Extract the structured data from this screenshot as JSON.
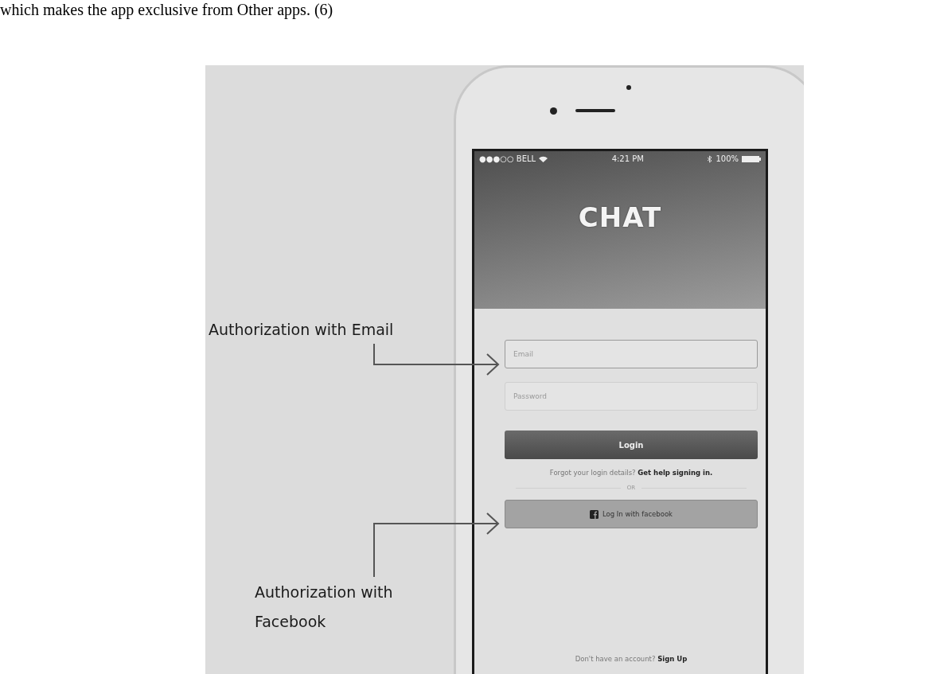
{
  "page_text": "which makes the app exclusive from Other apps. (6)",
  "annotations": [
    {
      "text": "Authorization with Email"
    },
    {
      "text": "Authorization with Facebook"
    }
  ],
  "phone": {
    "status_bar": {
      "carrier": "●●●○○ BELL",
      "time": "4:21 PM",
      "battery": "100%"
    },
    "app_title": "CHAT",
    "email_field": {
      "placeholder": "Email"
    },
    "password_field": {
      "placeholder": "Password"
    },
    "login_button": "Login",
    "forgot": "Forgot your login details? **Get help signing in.**",
    "divider": "OR",
    "facebook_button": "Log In with facebook",
    "signup": "Don't have an account? **Sign Up**"
  }
}
